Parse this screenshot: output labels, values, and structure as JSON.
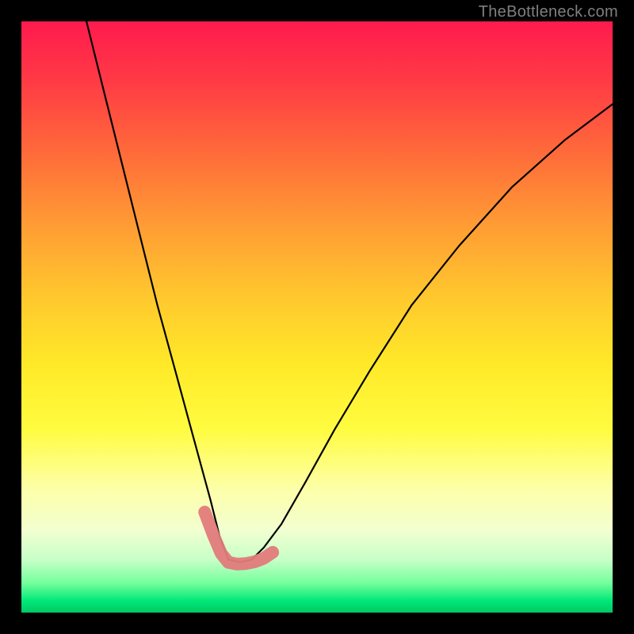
{
  "watermark": "TheBottleneck.com",
  "chart_data": {
    "type": "line",
    "title": "",
    "xlabel": "",
    "ylabel": "",
    "xlim": [
      0,
      100
    ],
    "ylim": [
      0,
      100
    ],
    "grid": false,
    "legend": false,
    "notes": "V-shaped bottleneck curve over vertical red→yellow→green gradient. Minimum (valley) near x≈35, y≈8. Pink/coral marker segment runs along the valley floor from roughly x≈32 to x≈42 at y≈8–16. No numeric axis ticks visible.",
    "series": [
      {
        "name": "curve",
        "x": [
          11,
          14,
          17,
          20,
          23,
          26,
          29,
          32,
          33.5,
          35,
          37,
          39,
          41,
          44,
          48,
          53,
          59,
          66,
          74,
          83,
          92,
          100
        ],
        "y": [
          100,
          88,
          76,
          64,
          52,
          41,
          30,
          19,
          13,
          9,
          8.5,
          9,
          11,
          15,
          22,
          31,
          41,
          52,
          62,
          72,
          80,
          86
        ]
      },
      {
        "name": "highlight",
        "x": [
          31,
          32.5,
          33.8,
          35,
          36.5,
          38,
          39.5,
          41,
          42.5
        ],
        "y": [
          17,
          13,
          10,
          8.5,
          8.2,
          8.3,
          8.6,
          9.2,
          10.2
        ]
      }
    ],
    "gradient_stops": [
      {
        "pos": 0.0,
        "color": "#ff1a4e"
      },
      {
        "pos": 0.5,
        "color": "#ffd82c"
      },
      {
        "pos": 0.8,
        "color": "#fbffb0"
      },
      {
        "pos": 0.95,
        "color": "#6fff98"
      },
      {
        "pos": 1.0,
        "color": "#00c864"
      }
    ]
  }
}
